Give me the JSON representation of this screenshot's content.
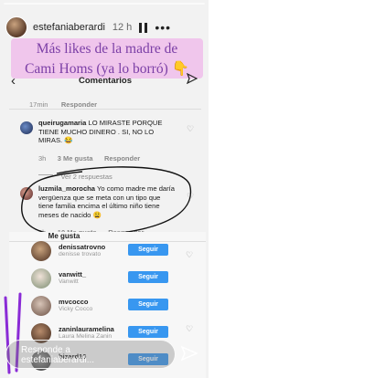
{
  "header": {
    "username": "estefaniaberardi",
    "time": "12 h"
  },
  "caption": {
    "line1": "Más likes de la madre de",
    "line2": "Cami Homs (ya lo borró) 👇"
  },
  "comments": {
    "title": "Comentarios",
    "first_meta": {
      "time": "17min",
      "reply": "Responder"
    },
    "items": [
      {
        "user": "queirugamaria",
        "text": "LO MIRASTE PORQUE TIENE MUCHO DINERO .  SI, NO LO MIRAS. 😂",
        "time": "3h",
        "likes": "3 Me gusta",
        "reply": "Responder"
      },
      {
        "view_replies": "Ver 2 respuestas"
      },
      {
        "user": "luzmila_morocha",
        "text": "Yo como madre me daría vergüenza que se meta con un tipo que tiene familia encima el último niño tiene meses  de nacido 😩",
        "time": "3h",
        "likes": "10 Me gusta",
        "reply": "Responder"
      }
    ]
  },
  "likes": {
    "title": "Me gusta",
    "follow_label": "Seguir",
    "people": [
      {
        "user": "denissatrovno",
        "name": "denisse trovato"
      },
      {
        "user": "vanwitt_",
        "name": "Vanwitt"
      },
      {
        "user": "mvcocco",
        "name": "Vicky Cocco"
      },
      {
        "user": "zaninlauramelina",
        "name": "Laura Melina Zanin"
      },
      {
        "user": "bizard10",
        "name": ""
      }
    ]
  },
  "reply_bar": {
    "line1": "Responde a",
    "line2": "estefaniaberardi..."
  },
  "colors": {
    "caption_bg": "#f0c6ec",
    "caption_text": "#7b3fa6",
    "follow_button": "#3897f0",
    "purple_stroke": "#8a2bd6"
  },
  "icons": [
    "back-icon",
    "send-icon",
    "heart-icon",
    "pause-icon",
    "close-icon",
    "more-icon"
  ]
}
